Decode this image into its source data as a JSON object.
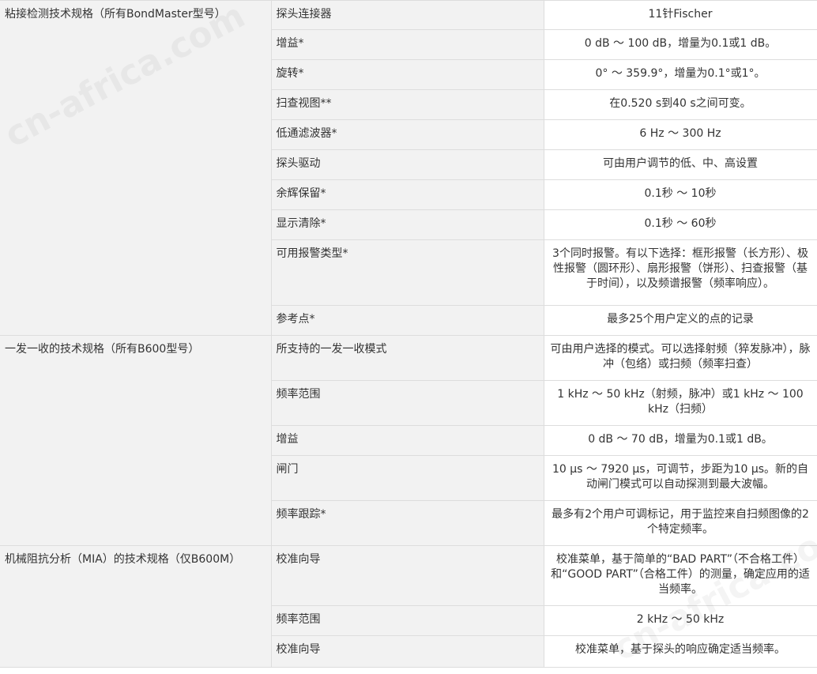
{
  "watermark": "cn-africa.com",
  "groups": [
    {
      "name": "粘接检测技术规格（所有BondMaster型号）",
      "rows": [
        {
          "param": "探头连接器",
          "value": "11针Fischer"
        },
        {
          "param": "增益*",
          "value": "0 dB ～ 100 dB，增量为0.1或1 dB。"
        },
        {
          "param": "旋转*",
          "value": "0° ～ 359.9°，增量为0.1°或1°。"
        },
        {
          "param": "扫查视图**",
          "value": "在0.520 s到40 s之间可变。"
        },
        {
          "param": "低通滤波器*",
          "value": "6 Hz ～ 300 Hz"
        },
        {
          "param": "探头驱动",
          "value": "可由用户调节的低、中、高设置"
        },
        {
          "param": "余辉保留*",
          "value": "0.1秒 ～ 10秒"
        },
        {
          "param": "显示清除*",
          "value": "0.1秒 ～ 60秒"
        },
        {
          "param": "可用报警类型*",
          "value": "3个同时报警。有以下选择：框形报警（长方形）、极性报警（圆环形）、扇形报警（饼形）、扫查报警（基于时间），以及频谱报警（频率响应）。"
        },
        {
          "param": "参考点*",
          "value": "最多25个用户定义的点的记录"
        }
      ]
    },
    {
      "name": "一发一收的技术规格（所有B600型号）",
      "rows": [
        {
          "param": "所支持的一发一收模式",
          "value": "可由用户选择的模式。可以选择射频（猝发脉冲），脉冲（包络）或扫频（频率扫查）"
        },
        {
          "param": "频率范围",
          "value": "1 kHz ～ 50 kHz（射频，脉冲）或1 kHz ～ 100 kHz（扫频）"
        },
        {
          "param": "增益",
          "value": "0 dB ～ 70 dB，增量为0.1或1 dB。"
        },
        {
          "param": "闸门",
          "value": "10 µs ～ 7920 µs，可调节，步距为10 µs。新的自动闸门模式可以自动探测到最大波幅。"
        },
        {
          "param": "频率跟踪*",
          "value": "最多有2个用户可调标记，用于监控来自扫频图像的2个特定频率。"
        }
      ]
    },
    {
      "name": "机械阻抗分析（MIA）的技术规格（仅B600M）",
      "rows": [
        {
          "param": "校准向导",
          "value": "校准菜单，基于简单的“BAD PART”（不合格工件）和“GOOD PART”（合格工件）的测量，确定应用的适当频率。"
        },
        {
          "param": "频率范围",
          "value": "2 kHz ～ 50 kHz"
        },
        {
          "param": "校准向导",
          "value": "校准菜单，基于探头的响应确定适当频率。"
        }
      ]
    }
  ]
}
